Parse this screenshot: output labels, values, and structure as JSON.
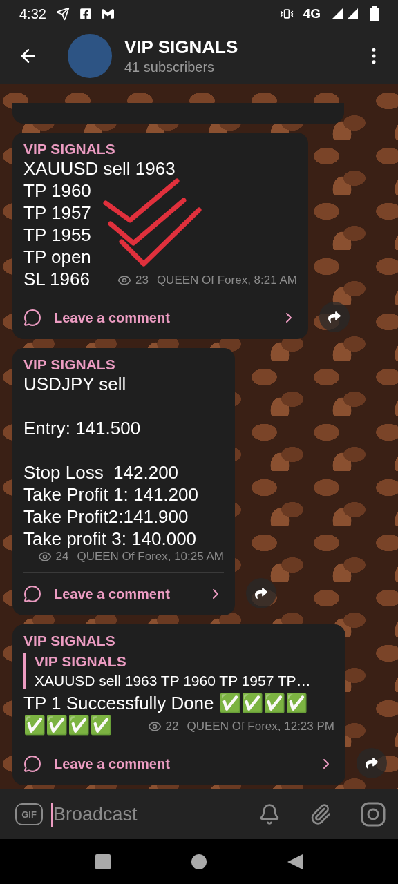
{
  "status_bar": {
    "time": "4:32",
    "network": "4G"
  },
  "header": {
    "title": "VIP SIGNALS",
    "subtitle": "41 subscribers"
  },
  "messages": [
    {
      "channel": "VIP SIGNALS",
      "paragraphs": [
        [
          "XAUUSD sell 1963",
          "TP 1960",
          "TP 1957",
          "TP 1955",
          "TP open",
          "SL 1966"
        ]
      ],
      "annotated": true,
      "views": "23",
      "author_time": "QUEEN Of Forex, 8:21 AM",
      "comment": "Leave a comment"
    },
    {
      "channel": "VIP SIGNALS",
      "paragraphs": [
        [
          "USDJPY sell"
        ],
        [
          "Entry: 141.500"
        ],
        [
          "Stop Loss  142.200",
          "Take Profit 1: 141.200",
          "Take Profit2:141.900",
          "Take profit 3: 140.000"
        ]
      ],
      "annotated": false,
      "views": "24",
      "author_time": "QUEEN Of Forex, 10:25 AM",
      "comment": "Leave a comment"
    },
    {
      "channel": "VIP SIGNALS",
      "reply": {
        "title": "VIP SIGNALS",
        "text": "XAUUSD sell 1963 TP 1960 TP 1957 TP…"
      },
      "paragraphs": [
        [
          "TP 1 Successfully Done ✅✅✅✅",
          "✅✅✅✅"
        ]
      ],
      "annotated": false,
      "views": "22",
      "author_time": "QUEEN Of Forex, 12:23 PM",
      "comment": "Leave a comment"
    }
  ],
  "composer": {
    "gif": "GIF",
    "placeholder": "Broadcast"
  }
}
